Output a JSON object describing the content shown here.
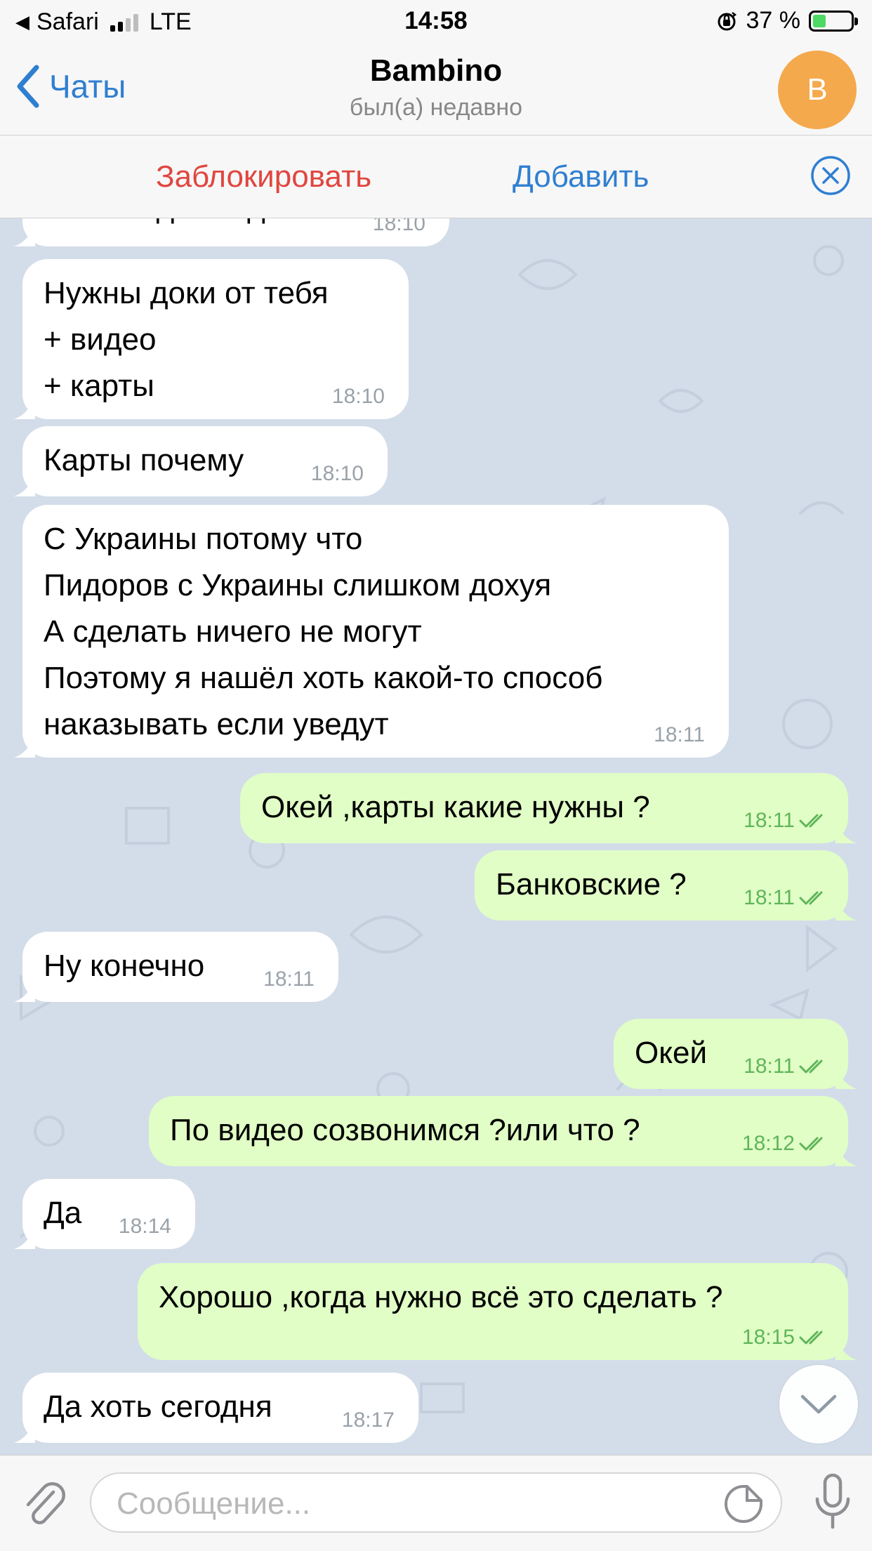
{
  "status_bar": {
    "back_app": "Safari",
    "network": "LTE",
    "time": "14:58",
    "battery_percent": "37 %",
    "battery_level": 0.37
  },
  "nav": {
    "back_label": "Чаты",
    "title": "Bambino",
    "subtitle": "был(а) недавно",
    "avatar_letter": "B",
    "avatar_color": "#f4a94c"
  },
  "actions": {
    "block": "Заблокировать",
    "add": "Добавить"
  },
  "messages": [
    {
      "dir": "in",
      "lines": [
        "Если под мой ден"
      ],
      "time": "18:10"
    },
    {
      "dir": "in",
      "lines": [
        "Нужны доки от тебя",
        "+ видео",
        "+ карты"
      ],
      "time": "18:10"
    },
    {
      "dir": "in",
      "lines": [
        "Карты почему"
      ],
      "time": "18:10"
    },
    {
      "dir": "in",
      "lines": [
        "С Украины потому что",
        "Пидоров с Украины слишком дохуя",
        "А сделать ничего не могут",
        "Поэтому я нашёл хоть какой-то способ",
        "наказывать если уведут"
      ],
      "time": "18:11"
    },
    {
      "dir": "out",
      "lines": [
        "Окей ,карты какие нужны ?"
      ],
      "time": "18:11",
      "read": true
    },
    {
      "dir": "out",
      "lines": [
        "Банковские ?"
      ],
      "time": "18:11",
      "read": true
    },
    {
      "dir": "in",
      "lines": [
        "Ну конечно"
      ],
      "time": "18:11"
    },
    {
      "dir": "out",
      "lines": [
        "Окей"
      ],
      "time": "18:11",
      "read": true
    },
    {
      "dir": "out",
      "lines": [
        "По видео созвонимся ?или что ?"
      ],
      "time": "18:12",
      "read": true
    },
    {
      "dir": "in",
      "lines": [
        "Да"
      ],
      "time": "18:14"
    },
    {
      "dir": "out",
      "lines": [
        "Хорошо ,когда нужно всё это сделать ?"
      ],
      "time": "18:15",
      "read": true
    },
    {
      "dir": "in",
      "lines": [
        "Да хоть сегодня"
      ],
      "time": "18:17"
    }
  ],
  "composer": {
    "placeholder": "Сообщение..."
  },
  "colors": {
    "accent": "#2f7fd1",
    "danger": "#e0463f",
    "outgoing_bubble": "#e1fec6",
    "incoming_bubble": "#ffffff",
    "chat_background": "#d3dde9"
  }
}
